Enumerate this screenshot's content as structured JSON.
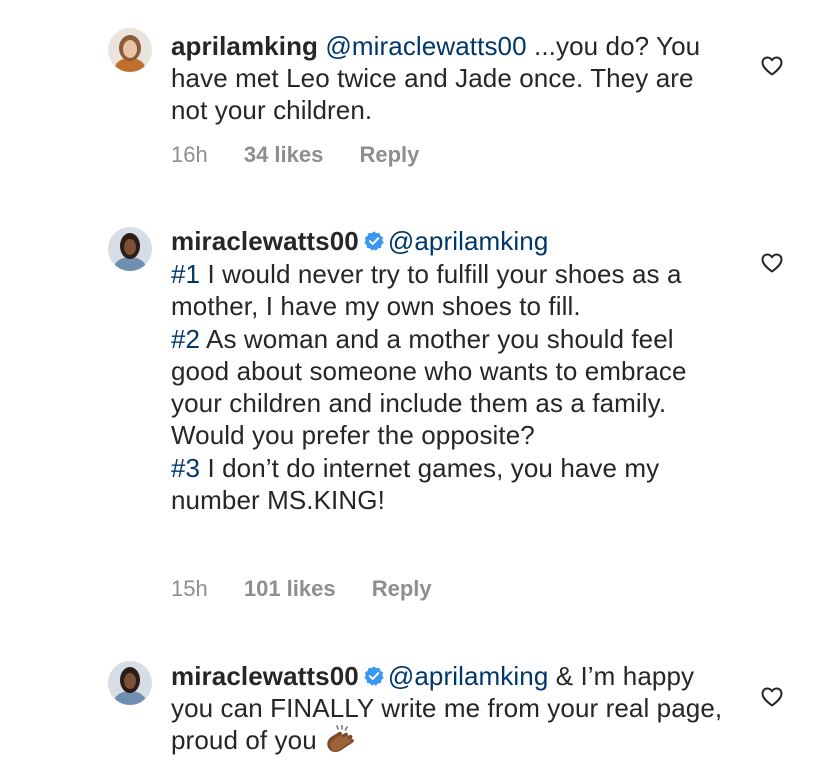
{
  "comments": [
    {
      "username": "aprilamking",
      "verified": false,
      "mention": "@miraclewatts00",
      "text_after_mention": " ...you do? You have met Leo twice and Jade once. They are not your children.",
      "time": "16h",
      "likes": "34 likes",
      "reply": "Reply",
      "avatar_icon": "avatar-photo-woman-light-hair"
    },
    {
      "username": "miraclewatts00",
      "verified": true,
      "mention": "@aprilamking",
      "paragraphs": [
        {
          "tag": "#1",
          "text": " I would never try to fulfill your shoes as a mother, I have my own shoes to fill."
        },
        {
          "tag": "#2",
          "text": " As woman and a mother you should feel good about someone who wants to embrace your children and include them as a family. Would you prefer the opposite?"
        },
        {
          "tag": "#3",
          "text": " I don’t do internet games, you have my number MS.KING!"
        }
      ],
      "time": "15h",
      "likes": "101 likes",
      "reply": "Reply",
      "avatar_icon": "avatar-photo-woman-dark-hair"
    },
    {
      "username": "miraclewatts00",
      "verified": true,
      "mention": "@aprilamking",
      "text_after_mention": " & I’m happy you can FINALLY write me from your real page, proud of you",
      "emoji": "clapping-hands-icon",
      "avatar_icon": "avatar-photo-woman-dark-hair"
    }
  ],
  "colors": {
    "text": "#262626",
    "link": "#00376b",
    "meta": "#8e8e8e",
    "verified": "#3897f0"
  }
}
